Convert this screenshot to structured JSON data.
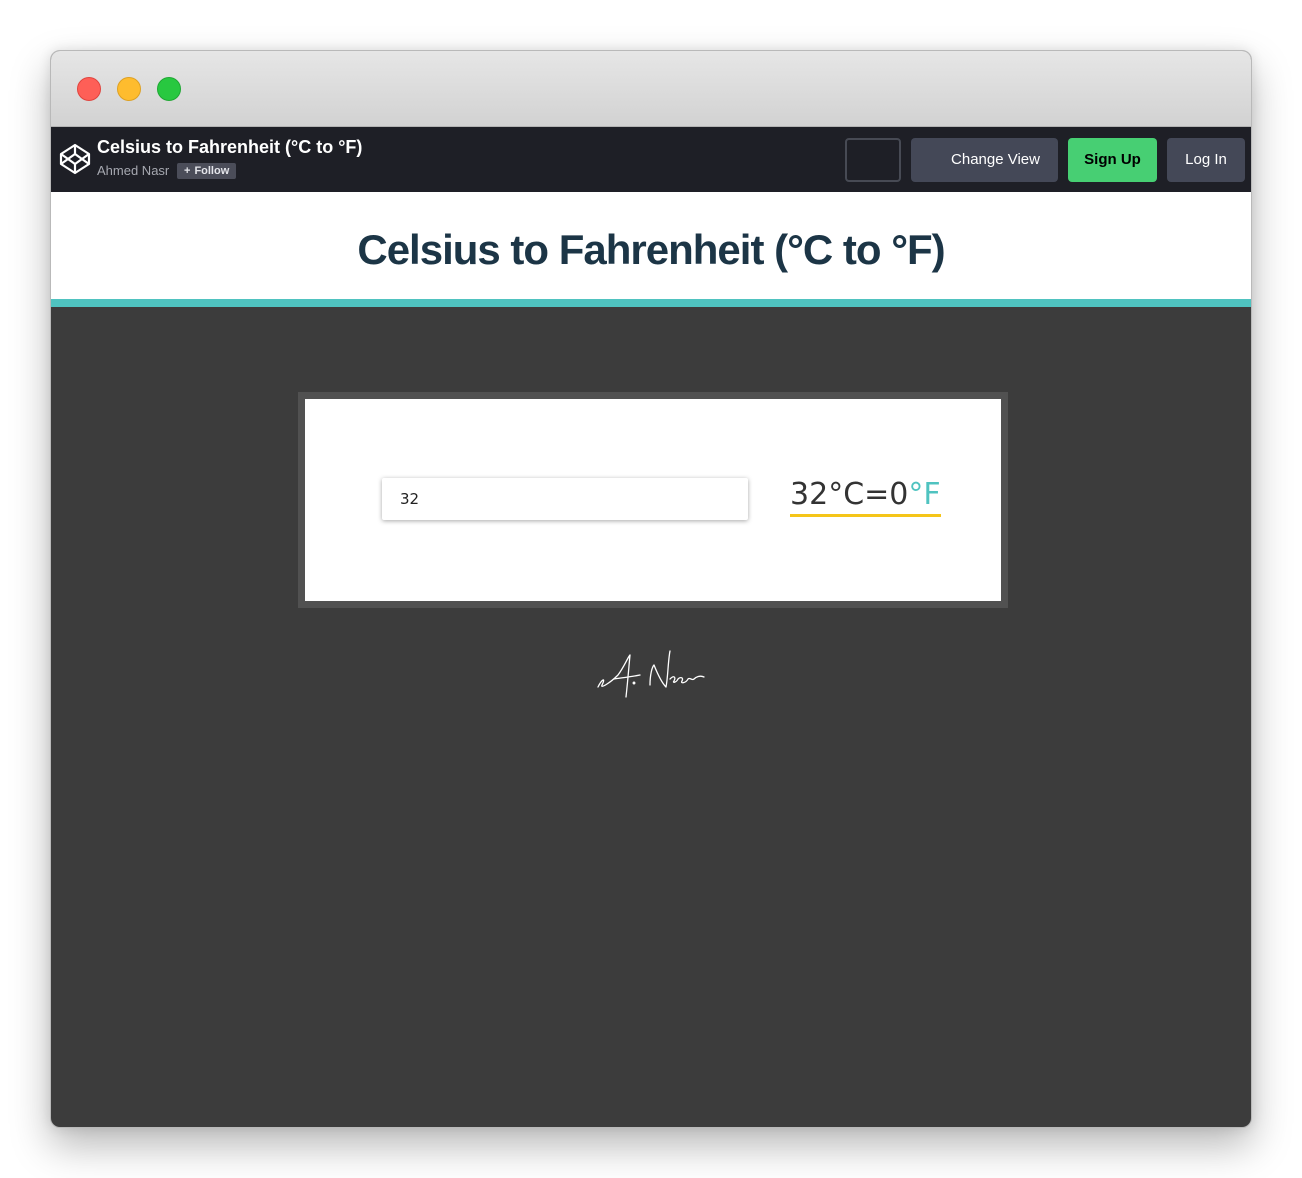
{
  "header": {
    "pen_title": "Celsius to Fahrenheit (°C to °F)",
    "author": "Ahmed Nasr",
    "follow_label": "Follow",
    "change_view_label": "Change View",
    "signup_label": "Sign Up",
    "login_label": "Log In"
  },
  "page": {
    "heading": "Celsius to Fahrenheit (°C to °F)"
  },
  "converter": {
    "input_value": "32",
    "result_celsius": "32",
    "result_celsius_unit": "°C",
    "result_equals": "=",
    "result_fahrenheit": "0",
    "result_fahrenheit_unit": "°F"
  },
  "signature": {
    "text": "A. Nasr"
  },
  "colors": {
    "accent_teal": "#4fc3c0",
    "underline_yellow": "#f5c518",
    "signup_green": "#47cf73",
    "heading_navy": "#1c3546",
    "page_background": "#3c3c3c"
  }
}
